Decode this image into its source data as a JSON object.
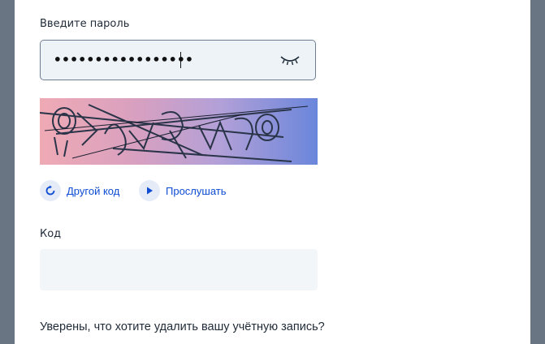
{
  "password": {
    "label": "Введите пароль",
    "masked_value": "•••••••••••••••••",
    "toggle_icon": "eye-closed-icon"
  },
  "captcha": {
    "refresh_label": "Другой код",
    "refresh_icon": "refresh-icon",
    "listen_label": "Прослушать",
    "listen_icon": "play-icon"
  },
  "code": {
    "label": "Код",
    "value": ""
  },
  "confirm": {
    "question": "Уверены, что хотите удалить вашу учётную запись?"
  },
  "colors": {
    "accent": "#0d4cd3",
    "field_bg": "#eef3f8",
    "page_bg": "#6a7584"
  }
}
